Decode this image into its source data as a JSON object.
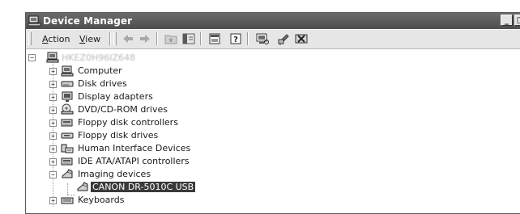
{
  "window": {
    "title": "Device Manager",
    "controls": [
      "_",
      "□"
    ]
  },
  "menu": {
    "action": {
      "accel": "A",
      "rest": "ction"
    },
    "view": {
      "accel": "V",
      "rest": "iew"
    }
  },
  "toolbar": {
    "buttons": [
      "back-icon",
      "forward-icon",
      "up-folder-icon",
      "show-hide-tree-icon",
      "properties-icon",
      "help-icon",
      "scan-hardware-icon",
      "update-driver-icon",
      "uninstall-icon"
    ]
  },
  "tree": {
    "root": {
      "label": "HKEZ0H96IZ648",
      "expander": "−"
    },
    "categories": [
      {
        "label": "Computer",
        "expander": "+",
        "icon": "computer-icon"
      },
      {
        "label": "Disk drives",
        "expander": "+",
        "icon": "disk-drive-icon"
      },
      {
        "label": "Display adapters",
        "expander": "+",
        "icon": "display-adapter-icon"
      },
      {
        "label": "DVD/CD-ROM drives",
        "expander": "+",
        "icon": "dvd-drive-icon"
      },
      {
        "label": "Floppy disk controllers",
        "expander": "+",
        "icon": "floppy-controller-icon"
      },
      {
        "label": "Floppy disk drives",
        "expander": "+",
        "icon": "floppy-drive-icon"
      },
      {
        "label": "Human Interface Devices",
        "expander": "+",
        "icon": "hid-icon"
      },
      {
        "label": "IDE ATA/ATAPI controllers",
        "expander": "+",
        "icon": "ide-controller-icon"
      },
      {
        "label": "Imaging devices",
        "expander": "−",
        "icon": "imaging-device-icon"
      },
      {
        "label": "Keyboards",
        "expander": "+",
        "icon": "keyboard-icon"
      }
    ],
    "child": {
      "label": "CANON DR-5010C USB",
      "icon": "scanner-icon"
    }
  }
}
